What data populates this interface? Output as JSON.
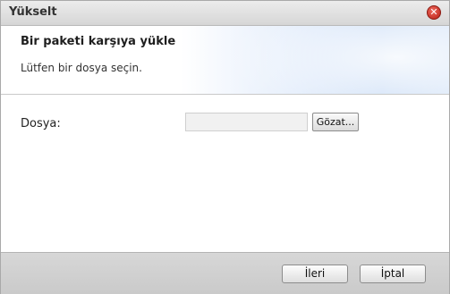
{
  "window": {
    "title": "Yükselt",
    "close_icon": "close-icon"
  },
  "header": {
    "heading": "Bir paketi karşıya yükle",
    "subtitle": "Lütfen bir dosya seçin."
  },
  "form": {
    "file_label": "Dosya:",
    "file_value": "",
    "browse_label": "Gözat..."
  },
  "footer": {
    "next_label": "İleri",
    "cancel_label": "İptal"
  },
  "colors": {
    "close_button": "#c8271c",
    "header_accent": "#c9dcf6",
    "footer_bg": "#d0d0d0"
  }
}
